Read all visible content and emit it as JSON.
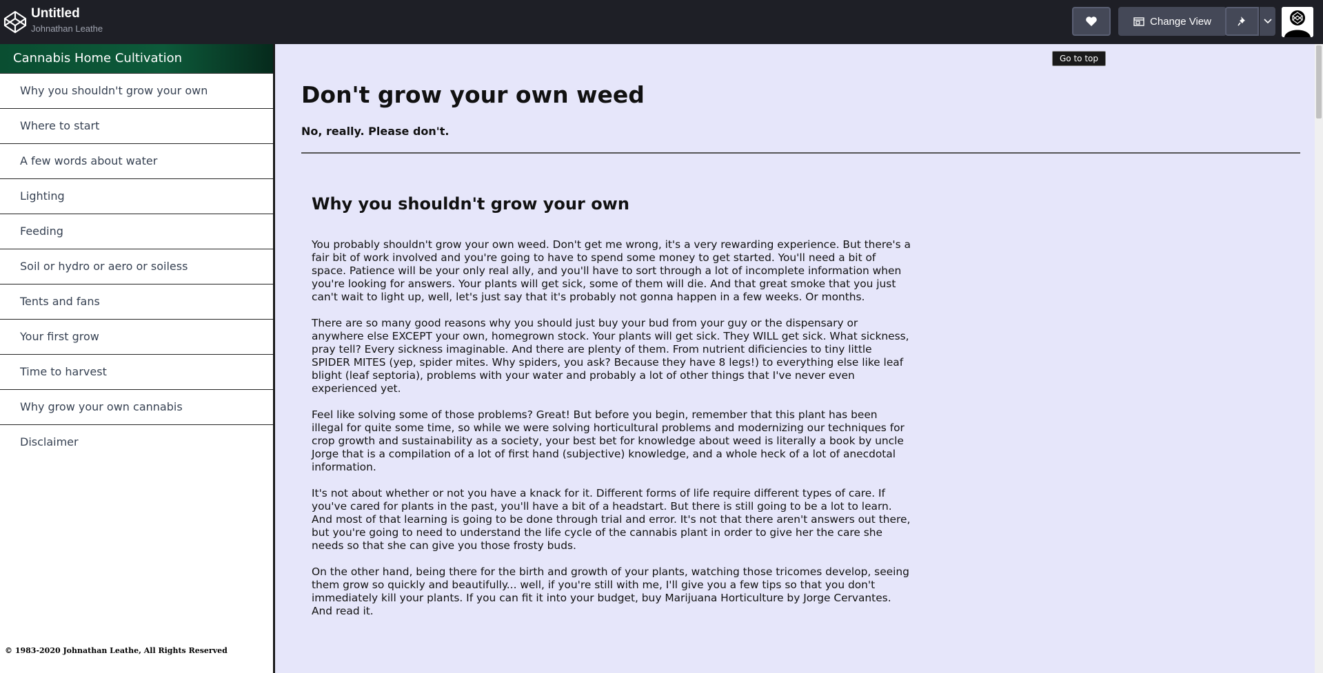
{
  "header": {
    "title": "Untitled",
    "author": "Johnathan Leathe",
    "change_view_label": "Change View"
  },
  "sidebar": {
    "title": "Cannabis Home Cultivation",
    "items": [
      {
        "label": "Why you shouldn't grow your own"
      },
      {
        "label": "Where to start"
      },
      {
        "label": "A few words about water"
      },
      {
        "label": "Lighting"
      },
      {
        "label": "Feeding"
      },
      {
        "label": "Soil or hydro or aero or soiless"
      },
      {
        "label": "Tents and fans"
      },
      {
        "label": "Your first grow"
      },
      {
        "label": "Time to harvest"
      },
      {
        "label": "Why grow your own cannabis"
      },
      {
        "label": "Disclaimer"
      }
    ],
    "copyright": "© 1983-2020 Johnathan Leathe, All Rights Reserved"
  },
  "main": {
    "goto_top": "Go to top",
    "title": "Don't grow your own weed",
    "subtitle": "No, really. Please don't.",
    "section_heading": "Why you shouldn't grow your own",
    "paragraphs": [
      "You probably shouldn't grow your own weed. Don't get me wrong, it's a very rewarding experience. But there's a fair bit of work involved and you're going to have to spend some money to get started. You'll need a bit of space. Patience will be your only real ally, and you'll have to sort through a lot of incomplete information when you're looking for answers. Your plants will get sick, some of them will die. And that great smoke that you just can't wait to light up, well, let's just say that it's probably not gonna happen in a few weeks. Or months.",
      "There are so many good reasons why you should just buy your bud from your guy or the dispensary or anywhere else EXCEPT your own, homegrown stock. Your plants will get sick. They WILL get sick. What sickness, pray tell? Every sickness imaginable. And there are plenty of them. From nutrient dificiencies to tiny little SPIDER MITES (yep, spider mites. Why spiders, you ask? Because they have 8 legs!) to everything else like leaf blight (leaf septoria), problems with your water and probably a lot of other things that I've never even experienced yet.",
      "Feel like solving some of those problems? Great! But before you begin, remember that this plant has been illegal for quite some time, so while we were solving horticultural problems and modernizing our techniques for crop growth and sustainability as a society, your best bet for knowledge about weed is literally a book by uncle Jorge that is a compilation of a lot of first hand (subjective) knowledge, and a whole heck of a lot of anecdotal information.",
      "It's not about whether or not you have a knack for it. Different forms of life require different types of care. If you've cared for plants in the past, you'll have a bit of a headstart. But there is still going to be a lot to learn. And most of that learning is going to be done through trial and error. It's not that there aren't answers out there, but you're going to need to understand the life cycle of the cannabis plant in order to give her the care she needs so that she can give you those frosty buds.",
      "On the other hand, being there for the birth and growth of your plants, watching those tricomes develop, seeing them grow so quickly and beautifully... well, if you're still with me, I'll give you a few tips so that you don't immediately kill your plants. If you can fit it into your budget, buy Marijuana Horticulture by Jorge Cervantes. And read it."
    ]
  }
}
